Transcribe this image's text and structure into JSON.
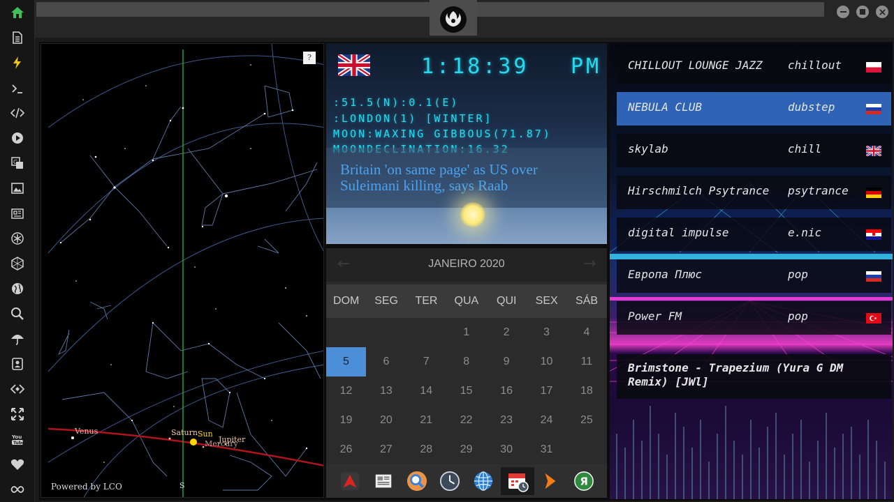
{
  "sidebar": {
    "items": [
      {
        "icon": "home-icon",
        "active": true
      },
      {
        "icon": "document-icon"
      },
      {
        "icon": "lightning-icon"
      },
      {
        "icon": "terminal-icon"
      },
      {
        "icon": "code-icon"
      },
      {
        "icon": "play-icon"
      },
      {
        "icon": "translate-icon"
      },
      {
        "icon": "image-icon"
      },
      {
        "icon": "news-icon"
      },
      {
        "icon": "asterisk-icon"
      },
      {
        "icon": "hexagon-icon"
      },
      {
        "icon": "globe-icon"
      },
      {
        "icon": "search-icon"
      },
      {
        "icon": "umbrella-icon"
      },
      {
        "icon": "contact-icon"
      },
      {
        "icon": "code-brackets-icon"
      },
      {
        "icon": "expand-icon"
      },
      {
        "icon": "youtube-icon"
      },
      {
        "icon": "heart-icon"
      },
      {
        "icon": "infinity-icon"
      }
    ]
  },
  "skymap": {
    "help_label": "?",
    "powered_by": "Powered by LCO",
    "south_label": "S",
    "planets": {
      "venus": "Venus",
      "saturn": "Saturn",
      "sun": "Sun",
      "jupiter": "Jupiter",
      "mercury": "Mercury"
    }
  },
  "clock": {
    "time": "1:18:39",
    "ampm": "PM",
    "coords": ":51.5(N):0.1(E)",
    "location": ":LONDON(1) [WINTER]",
    "moon": "MOON:WAXING GIBBOUS(71.87)",
    "moon_declination": "MOONDECLINATION:16.32",
    "news": "Britain 'on same page' as US over Suleimani killing, says Raab"
  },
  "calendar": {
    "month": "JANEIRO 2020",
    "prev": "←",
    "next": "→",
    "weekdays": [
      "DOM",
      "SEG",
      "TER",
      "QUA",
      "QUI",
      "SEX",
      "SÁB"
    ],
    "first_weekday_index": 3,
    "days_in_month": 31,
    "today": 5
  },
  "dock": {
    "items": [
      {
        "icon": "app-launcher-icon"
      },
      {
        "icon": "news-reader-icon"
      },
      {
        "icon": "search-app-icon"
      },
      {
        "icon": "clock-app-icon"
      },
      {
        "icon": "globe-app-icon"
      },
      {
        "icon": "calendar-app-icon",
        "active": true
      },
      {
        "icon": "arrow-app-icon"
      },
      {
        "icon": "yandex-app-icon"
      }
    ]
  },
  "radio": {
    "stations": [
      {
        "name": "CHILLOUT LOUNGE JAZZ",
        "genre": "chillout",
        "flag": "pl"
      },
      {
        "name": "NEBULA CLUB",
        "genre": "dubstep",
        "flag": "ru",
        "active": true
      },
      {
        "name": "skylab",
        "genre": "chill",
        "flag": "uk"
      },
      {
        "name": "Hirschmilch Psytrance",
        "genre": "psytrance",
        "flag": "de"
      },
      {
        "name": "digital impulse",
        "genre": "e.nic",
        "flag": "hr"
      },
      {
        "name": "Европа Плюс",
        "genre": "pop",
        "flag": "ru"
      },
      {
        "name": "Power FM",
        "genre": "pop",
        "flag": "tr"
      }
    ],
    "now_playing": "Brimstone - Trapezium (Yura G DM Remix) [JWl]"
  },
  "colors": {
    "accent_cyan": "#27d9ee",
    "news_blue": "#4aa3ee",
    "today_blue": "#4d8ed8",
    "station_active": "#2f63b5",
    "ecliptic_red": "#b0141e",
    "meridian_green": "#1fa12a"
  }
}
